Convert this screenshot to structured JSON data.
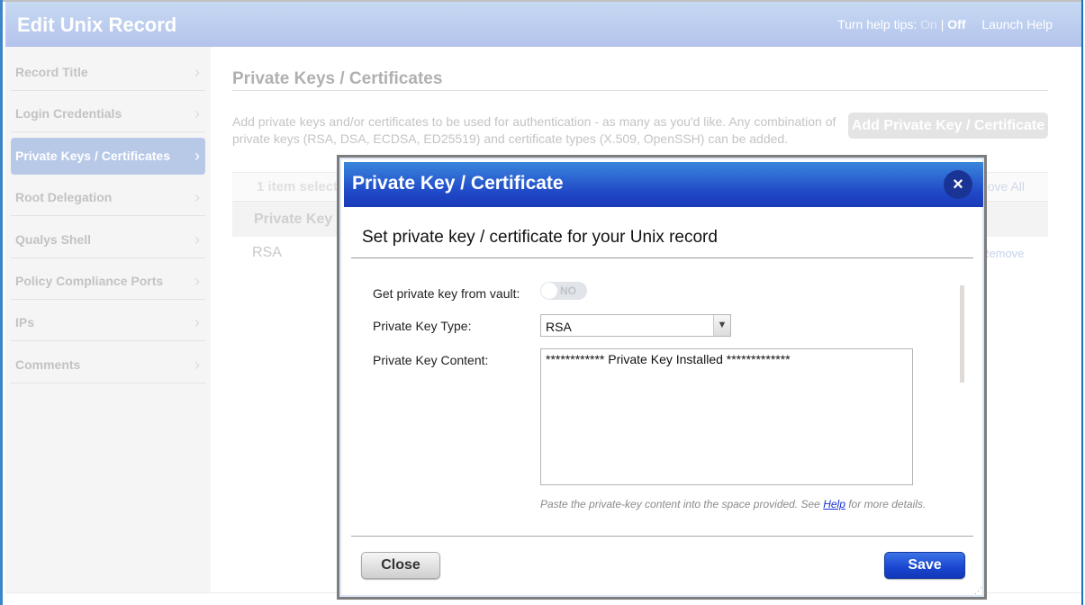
{
  "header": {
    "title": "Edit Unix Record",
    "help_tips_label": "Turn help tips:",
    "help_on": "On",
    "help_separator": "|",
    "help_off": "Off",
    "launch_help": "Launch Help"
  },
  "sidebar": {
    "items": [
      {
        "label": "Record Title",
        "active": false
      },
      {
        "label": "Login Credentials",
        "active": false
      },
      {
        "label": "Private Keys / Certificates",
        "active": true
      },
      {
        "label": "Root Delegation",
        "active": false
      },
      {
        "label": "Qualys Shell",
        "active": false
      },
      {
        "label": "Policy Compliance Ports",
        "active": false
      },
      {
        "label": "IPs",
        "active": false
      },
      {
        "label": "Comments",
        "active": false
      }
    ],
    "chevron": "›"
  },
  "main": {
    "title": "Private Keys / Certificates",
    "description": "Add private keys and/or certificates to be used for authentication - as many as you'd like. Any combination of private keys (RSA, DSA, ECDSA, ED25519) and certificate types (X.509, OpenSSH) can be added.",
    "add_button": "Add Private Key / Certificate",
    "table": {
      "selection_text": "1 item selected",
      "remove_all": "Remove All",
      "columns": [
        "Private Key Type"
      ],
      "rows": [
        {
          "type": "RSA",
          "action": "Remove"
        }
      ]
    }
  },
  "modal": {
    "title": "Private Key / Certificate",
    "close_icon": "×",
    "subtitle": "Set private key / certificate for your Unix record",
    "fields": {
      "vault_label": "Get private key from vault:",
      "vault_toggle": "NO",
      "vault_on": false,
      "key_type_label": "Private Key Type:",
      "key_type_value": "RSA",
      "key_content_label": "Private Key Content:",
      "key_content_value": "************ Private Key Installed *************"
    },
    "hint_prefix": "Paste the private-key content into the space provided. See ",
    "hint_link": "Help",
    "hint_suffix": " for more details.",
    "close_button": "Close",
    "save_button": "Save"
  },
  "colors": {
    "header_bg": "#b4c3ec",
    "modal_header": "#1f46c6",
    "save_button": "#1945d0",
    "active_sidebar": "#b8c9e8"
  }
}
